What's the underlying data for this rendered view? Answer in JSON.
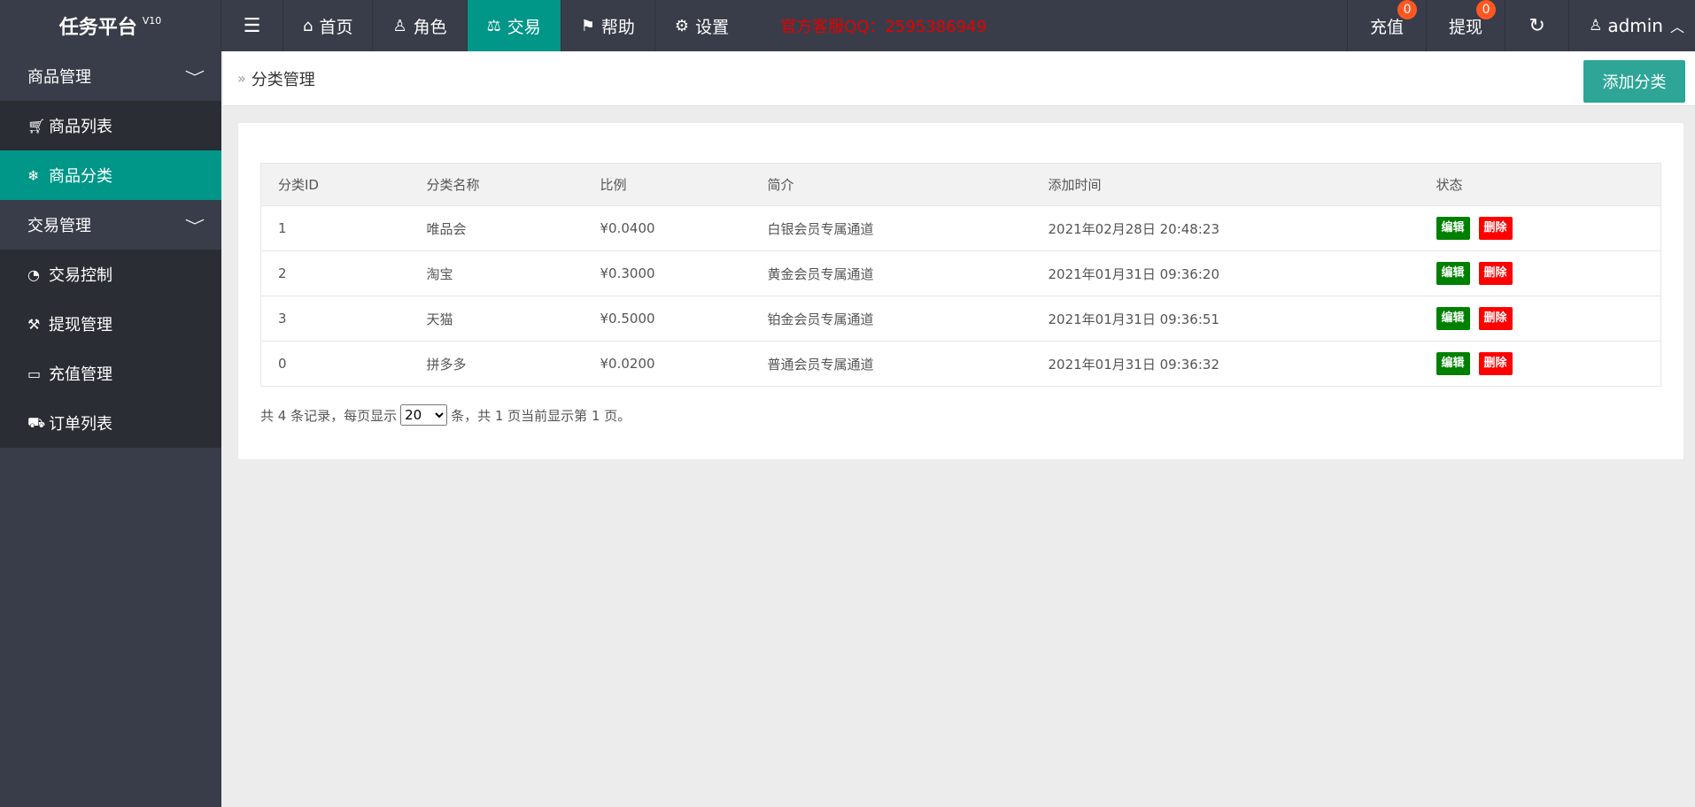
{
  "header": {
    "logo": "任务平台",
    "version": "V10",
    "nav": [
      {
        "label": "首页",
        "icon": "home-icon"
      },
      {
        "label": "角色",
        "icon": "user-icon"
      },
      {
        "label": "交易",
        "icon": "scale-icon",
        "active": true
      },
      {
        "label": "帮助",
        "icon": "flag-icon"
      },
      {
        "label": "设置",
        "icon": "gear-icon"
      }
    ],
    "hotline": "官方客服QQ：2595386949",
    "recharge_label": "充值",
    "recharge_badge": "0",
    "withdraw_label": "提现",
    "withdraw_badge": "0",
    "user": "admin"
  },
  "sidebar": {
    "group1": "商品管理",
    "item_product_list": "商品列表",
    "item_product_category": "商品分类",
    "group2": "交易管理",
    "item_trade_control": "交易控制",
    "item_withdraw": "提现管理",
    "item_recharge": "充值管理",
    "item_orders": "订单列表"
  },
  "content": {
    "breadcrumb": "分类管理",
    "add_button": "添加分类",
    "table": {
      "headers": [
        "分类ID",
        "分类名称",
        "比例",
        "简介",
        "添加时间",
        "状态"
      ],
      "rows": [
        [
          "1",
          "唯品会",
          "¥0.0400",
          "白银会员专属通道",
          "2021年02月28日 20:48:23"
        ],
        [
          "2",
          "淘宝",
          "¥0.3000",
          "黄金会员专属通道",
          "2021年01月31日 09:36:20"
        ],
        [
          "3",
          "天猫",
          "¥0.5000",
          "铂金会员专属通道",
          "2021年01月31日 09:36:51"
        ],
        [
          "0",
          "拼多多",
          "¥0.0200",
          "普通会员专属通道",
          "2021年01月31日 09:36:32"
        ]
      ],
      "edit_label": "编辑",
      "delete_label": "删除"
    },
    "pager": {
      "prefix": "共 4 条记录，每页显示",
      "page_size": "20",
      "suffix": "条，共 1 页当前显示第 1 页。"
    }
  },
  "colors": {
    "header_bg": "#393d49",
    "active_bg": "#009688",
    "hotline": "#e60000",
    "edit": "#008000",
    "delete": "#ff0000"
  }
}
